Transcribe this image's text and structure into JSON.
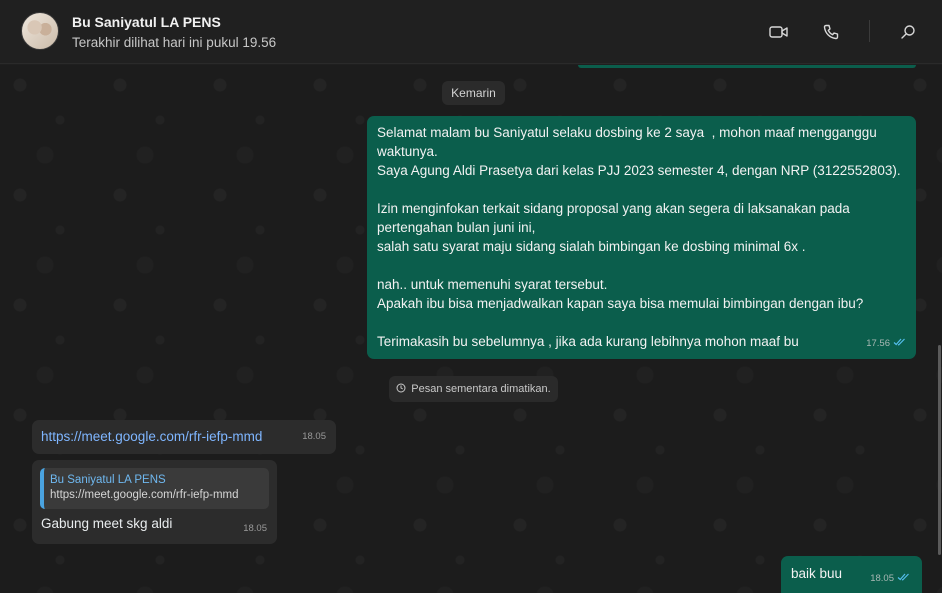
{
  "header": {
    "contact_name": "Bu Saniyatul LA PENS",
    "status": "Terakhir dilihat hari ini pukul 19.56",
    "icons": [
      "video-call-icon",
      "voice-call-icon",
      "search-icon"
    ]
  },
  "chat": {
    "date_separator": "Kemarin",
    "outgoing_main": {
      "lines": [
        "Selamat malam bu Saniyatul selaku dosbing ke 2 saya  , mohon maaf mengganggu",
        "waktunya.",
        "Saya Agung Aldi Prasetya dari kelas PJJ 2023 semester 4, dengan NRP (3122552803).",
        "",
        "Izin menginfokan terkait sidang proposal yang akan segera di laksanakan pada",
        "pertengahan bulan juni ini,",
        "salah satu syarat maju sidang sialah bimbingan ke dosbing minimal 6x .",
        "",
        "nah.. untuk memenuhi syarat tersebut.",
        "Apakah ibu bisa menjadwalkan kapan saya bisa memulai bimbingan dengan ibu?",
        "",
        "Terimakasih bu sebelumnya , jika ada kurang lebihnya mohon maaf bu"
      ],
      "time": "17.56"
    },
    "system_notice": "Pesan sementara dimatikan.",
    "incoming_link": {
      "text": "https://meet.google.com/rfr-iefp-mmd",
      "time": "18.05"
    },
    "incoming_reply": {
      "quote_author": "Bu Saniyatul LA PENS",
      "quote_text": "https://meet.google.com/rfr-iefp-mmd",
      "text": "Gabung meet skg aldi",
      "time": "18.05"
    },
    "outgoing_short": {
      "text": "baik buu",
      "time": "18.05"
    }
  },
  "colors": {
    "outgoing_bubble": "#0b5e4c",
    "incoming_bubble": "#2c2c2c",
    "read_ticks": "#53bdeb",
    "link": "#7fb6ff"
  }
}
